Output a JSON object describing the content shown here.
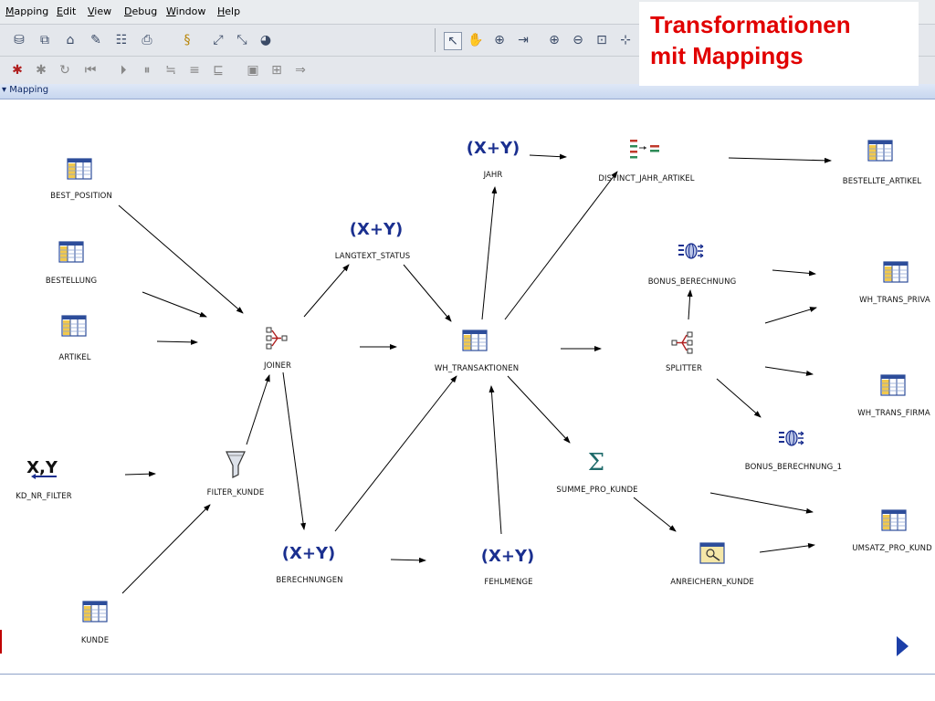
{
  "menubar": {
    "items": [
      "Mapping",
      "Edit",
      "View",
      "Debug",
      "Window",
      "Help"
    ]
  },
  "tab": {
    "label": "Mapping"
  },
  "title": {
    "line1": "Transformationen",
    "line2": "mit Mappings"
  },
  "nodes": {
    "best_position": "BEST_POSITION",
    "bestellung": "BESTELLUNG",
    "artikel": "ARTIKEL",
    "joiner": "JOINER",
    "langtext_status": "LANGTEXT_STATUS",
    "jahr": "JAHR",
    "distinct_jahr_artikel": "DISTINCT_JAHR_ARTIKEL",
    "bestellte_artikel": "BESTELLTE_ARTIKEL",
    "wh_transaktionen": "WH_TRANSAKTIONEN",
    "bonus_berechnung": "BONUS_BERECHNUNG",
    "wh_trans_privat": "WH_TRANS_PRIVA",
    "splitter": "SPLITTER",
    "wh_trans_firma": "WH_TRANS_FIRMA",
    "bonus_berechnung_1": "BONUS_BERECHNUNG_1",
    "kd_nr_filter": "KD_NR_FILTER",
    "filter_kunde": "FILTER_KUNDE",
    "summe_pro_kunde": "SUMME_PRO_KUNDE",
    "umsatz_pro_kunde": "UMSATZ_PRO_KUND",
    "berechnungen": "BERECHNUNGEN",
    "fehlmenge": "FEHLMENGE",
    "anreichern_kunde": "ANREICHERN_KUNDE",
    "kunde": "KUNDE"
  },
  "glyphs": {
    "expression": "(X+Y)",
    "constant": "X,Y",
    "sigma": "Σ"
  },
  "colors": {
    "accent_title": "#e10000",
    "table_icon": "#2d4d9a",
    "expression_icon": "#1a2f8f",
    "edge": "#000000"
  }
}
